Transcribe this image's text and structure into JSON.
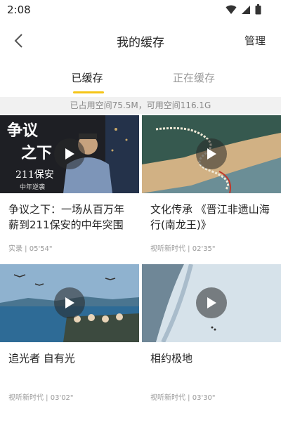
{
  "status_bar": {
    "time": "2:08"
  },
  "header": {
    "title": "我的缓存",
    "manage_label": "管理"
  },
  "tabs": [
    {
      "label": "已缓存",
      "active": true
    },
    {
      "label": "正在缓存",
      "active": false
    }
  ],
  "storage_info": "已占用空间75.5M，可用空间116.1G",
  "thumbnail_captions": {
    "card1_line1": "争议",
    "card1_line2": "之下",
    "card1_line3": "211保安",
    "card1_line4": "中年逆袭"
  },
  "videos": [
    {
      "title": "争议之下：一场从百万年薪到211保安的中年突围",
      "meta": "实录 | 05'54\""
    },
    {
      "title": "文化传承 《晋江非遗山海行(南龙王)》",
      "meta": "视听新时代 | 02'35\""
    },
    {
      "title": "追光者 自有光",
      "meta": "视听新时代 | 03'02\""
    },
    {
      "title": "相约极地",
      "meta": "视听新时代 | 03'30\""
    }
  ],
  "colors": {
    "accent": "#f5c518",
    "storage_bg": "#f1f1f1"
  },
  "icons": [
    "wifi-icon",
    "signal-icon",
    "battery-icon",
    "back-icon",
    "play-icon"
  ]
}
